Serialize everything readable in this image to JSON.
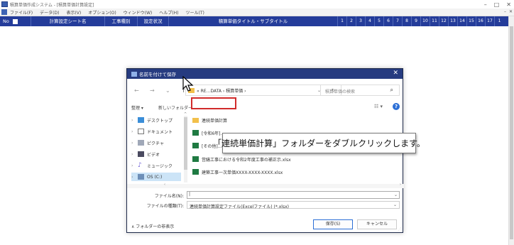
{
  "window": {
    "title": "積算単価作成システム - [積算単価計算設定]",
    "controls": [
      "–",
      "□",
      "✕"
    ]
  },
  "menu": [
    "ファイル(F)",
    "データ(D)",
    "表示(V)",
    "オプション(O)",
    "ウィンドウ(W)",
    "ヘルプ(H)",
    "ツール(T)"
  ],
  "menu_right": [
    "–",
    "✕"
  ],
  "grid_header": {
    "no": "No",
    "sheet_name": "計算設定シート名",
    "work_type": "工事種別",
    "setting_status": "設定状況",
    "title": "積算単価タイトル・サブタイトル",
    "numbers": [
      "1",
      "2",
      "3",
      "4",
      "5",
      "6",
      "7",
      "8",
      "9",
      "10",
      "11",
      "12",
      "13",
      "14",
      "15",
      "16",
      "17",
      "1"
    ]
  },
  "dialog": {
    "title": "名前を付けて保存",
    "close": "✕",
    "nav_back": "←",
    "nav_forward": "→",
    "nav_down": "⌄",
    "nav_up": "↑",
    "address": "« RE…DATA › 積算単価 ›",
    "address_dropdown": "⌄",
    "refresh": "↻",
    "search_placeholder": "積算単価の検索",
    "organize": "整理 ▾",
    "new_folder": "新しいフォルダー",
    "view_icon": "☷ ▾",
    "help": "?",
    "nav_items": [
      {
        "label": "デスクトップ",
        "icon": "desktop-icon"
      },
      {
        "label": "ドキュメント",
        "icon": "documents-icon"
      },
      {
        "label": "ピクチャ",
        "icon": "pictures-icon"
      },
      {
        "label": "ビデオ",
        "icon": "videos-icon"
      },
      {
        "label": "ミュージック",
        "icon": "music-icon"
      },
      {
        "label": "OS (C:)",
        "icon": "drive-icon"
      }
    ],
    "files": [
      {
        "name": "連続単価計算",
        "type": "folder"
      },
      {
        "name": "[令和6年]…",
        "type": "xlsx"
      },
      {
        "name": "[その他]…",
        "type": "xlsx"
      },
      {
        "name": "営繕工事における令和2年度工事の補正示.xlsx",
        "type": "xlsx"
      },
      {
        "name": "建築工事一次単価XXXX-XXXX-XXXX.xlsx",
        "type": "xlsx"
      }
    ],
    "filename_label": "ファイル名(N):",
    "filename_value": "",
    "filetype_label": "ファイルの種類(T):",
    "filetype_value": "連続単価計算設定ファイル(Excelファイル) (*.xlsx)",
    "hide_folders": "∧ フォルダーの非表示",
    "save_button": "保存(S)",
    "cancel_button": "キャンセル"
  },
  "callout": "「連続単価計算」フォルダーをダブルクリックします。",
  "colors": {
    "header_bg": "#243c9a",
    "dialog_title_bg": "#263b80",
    "highlight": "#d12b2b"
  }
}
